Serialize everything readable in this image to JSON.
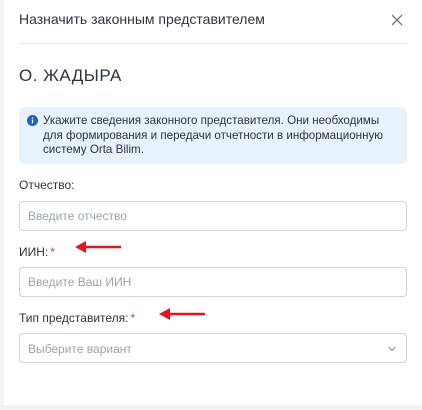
{
  "modal": {
    "title": "Назначить законным представителем",
    "close_icon": "close-icon"
  },
  "person": {
    "name": "О. ЖАДЫРА"
  },
  "info": {
    "icon": "info-icon",
    "accent": "#1e63c4",
    "text": "Укажите сведения законного представителя. Они необходимы для формирования и передачи отчетности в информационную систему Orta Bilim."
  },
  "fields": {
    "patronymic": {
      "label": "Отчество:",
      "placeholder": "Введите отчество",
      "value": ""
    },
    "iin": {
      "label": "ИИН:",
      "required_mark": "*",
      "placeholder": "Введите Ваш ИИН",
      "value": ""
    },
    "rep_type": {
      "label": "Тип представителя:",
      "required_mark": "*",
      "selected": "Выберите вариант"
    }
  },
  "annotation": {
    "arrow_color": "#e8131d",
    "arrow_icon": "arrow-left-icon"
  }
}
